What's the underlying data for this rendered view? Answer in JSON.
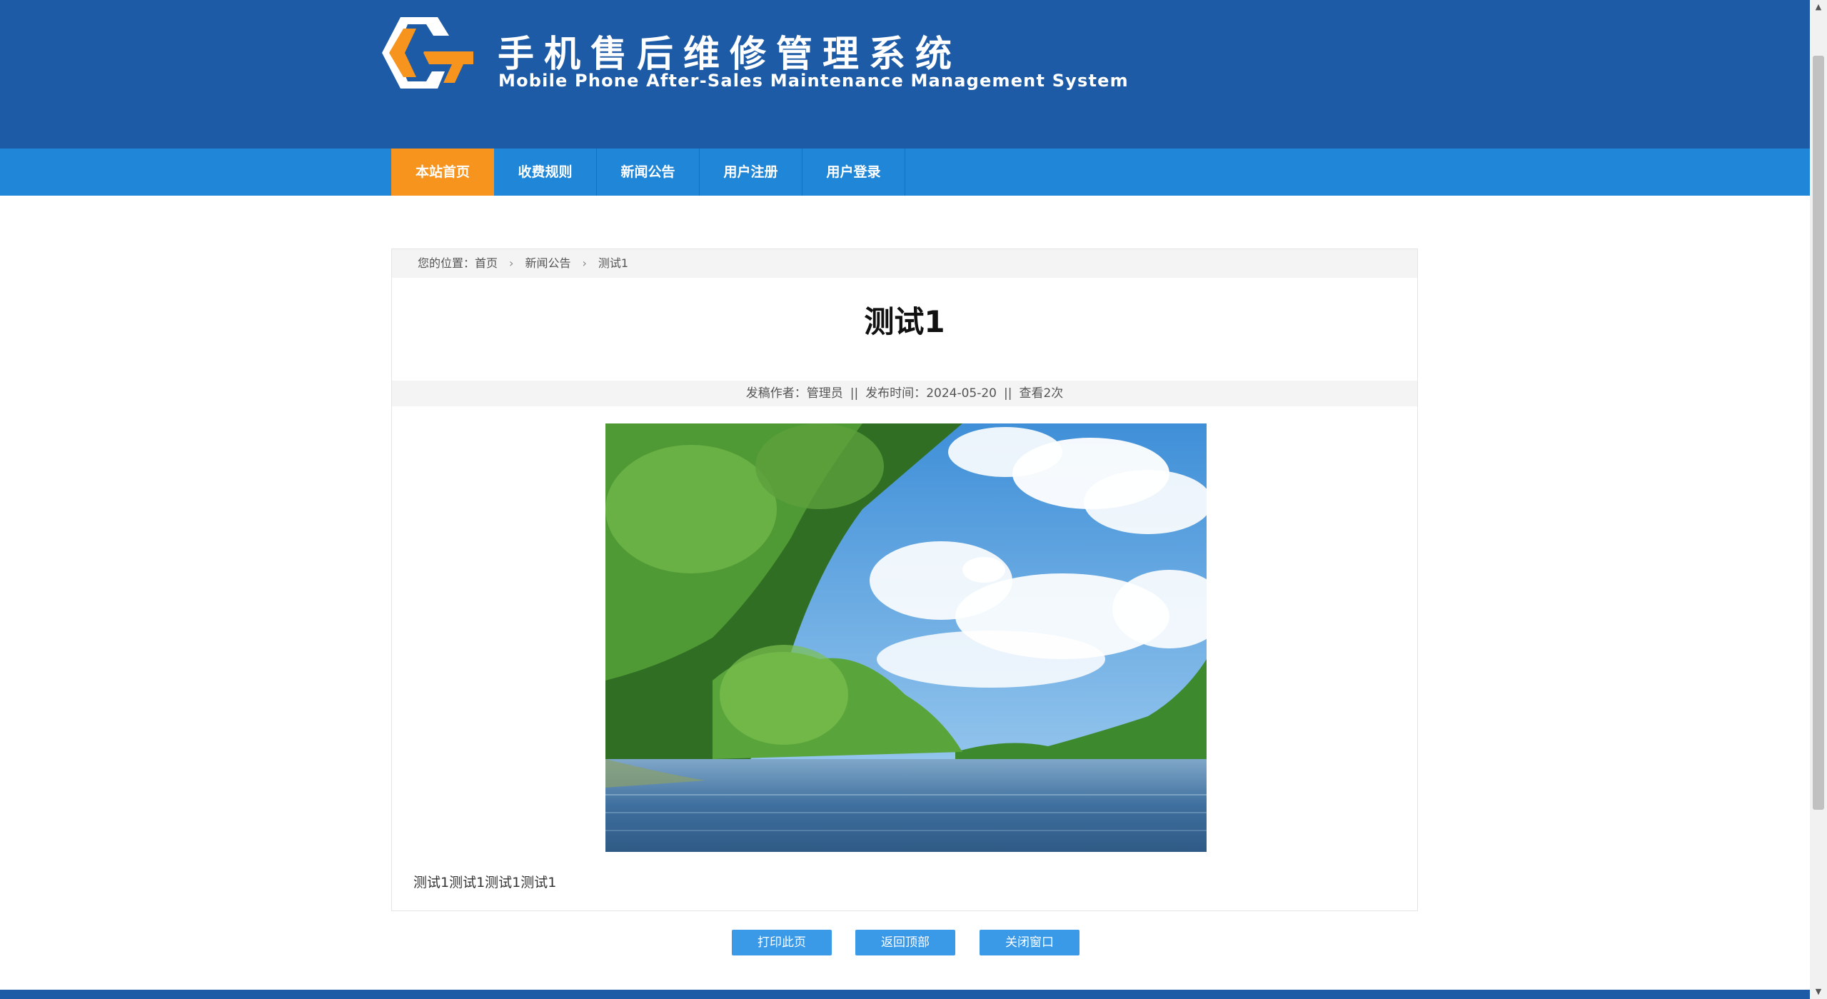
{
  "header": {
    "title_cn": "手机售后维修管理系统",
    "title_en": "Mobile Phone After-Sales Maintenance Management System",
    "logo_icon": "hexagon-g-logo-icon",
    "colors": {
      "header_bg": "#1d5ba7",
      "nav_bg": "#1f86d8",
      "active": "#f7941d"
    }
  },
  "nav": {
    "items": [
      {
        "label": "本站首页",
        "active": true
      },
      {
        "label": "收费规则",
        "active": false
      },
      {
        "label": "新闻公告",
        "active": false
      },
      {
        "label": "用户注册",
        "active": false
      },
      {
        "label": "用户登录",
        "active": false
      }
    ]
  },
  "breadcrumb": {
    "prefix": "您的位置：",
    "items": [
      "首页",
      "新闻公告",
      "测试1"
    ],
    "separator_icon": "chevron-right-icon"
  },
  "article": {
    "title": "测试1",
    "author_label": "发稿作者：",
    "author": "管理员",
    "divider": "||",
    "date_label": "发布时间：",
    "date": "2024-05-20",
    "views": "查看2次",
    "image_description_icon": "landscape-photo",
    "body": "测试1测试1测试1测试1"
  },
  "actions": {
    "print": "打印此页",
    "top": "返回顶部",
    "close": "关闭窗口"
  }
}
